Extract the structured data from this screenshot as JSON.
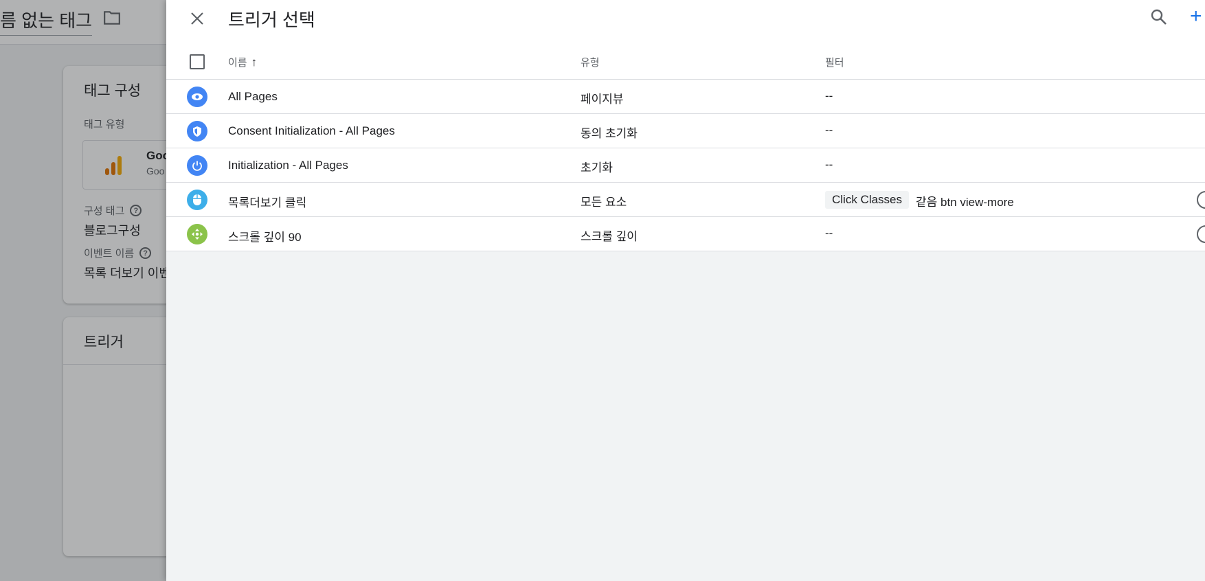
{
  "background": {
    "tag_title": "름 없는 태그",
    "tag_config_card": {
      "title": "태그 구성",
      "tag_type_label": "태그 유형",
      "tag_type_name": "Goo",
      "tag_type_sub": "Goo",
      "config_tag_label": "구성 태그",
      "config_tag_value": "블로그구성",
      "event_name_label": "이벤트 이름",
      "event_name_value": "목록 더보기 이벤"
    },
    "trigger_card": {
      "title": "트리거"
    }
  },
  "panel": {
    "title": "트리거 선택",
    "add_symbol": "+",
    "columns": {
      "name": "이름",
      "sort_arrow": "↑",
      "type": "유형",
      "filter": "필터"
    },
    "rows": [
      {
        "icon": "eye-icon",
        "icon_color": "#4285f4",
        "name": "All Pages",
        "type": "페이지뷰",
        "filter": "--"
      },
      {
        "icon": "shield-icon",
        "icon_color": "#4285f4",
        "name": "Consent Initialization - All Pages",
        "type": "동의 초기화",
        "filter": "--"
      },
      {
        "icon": "power-icon",
        "icon_color": "#4285f4",
        "name": "Initialization - All Pages",
        "type": "초기화",
        "filter": "--"
      },
      {
        "icon": "mouse-icon",
        "icon_color": "#3daee9",
        "name": "목록더보기 클릭",
        "type": "모든 요소",
        "filter_chip": "Click Classes",
        "filter_text": "같음 btn view-more"
      },
      {
        "icon": "scroll-icon",
        "icon_color": "#8bc34a",
        "name": "스크롤 깊이 90",
        "type": "스크롤 깊이",
        "filter": "--"
      }
    ]
  }
}
